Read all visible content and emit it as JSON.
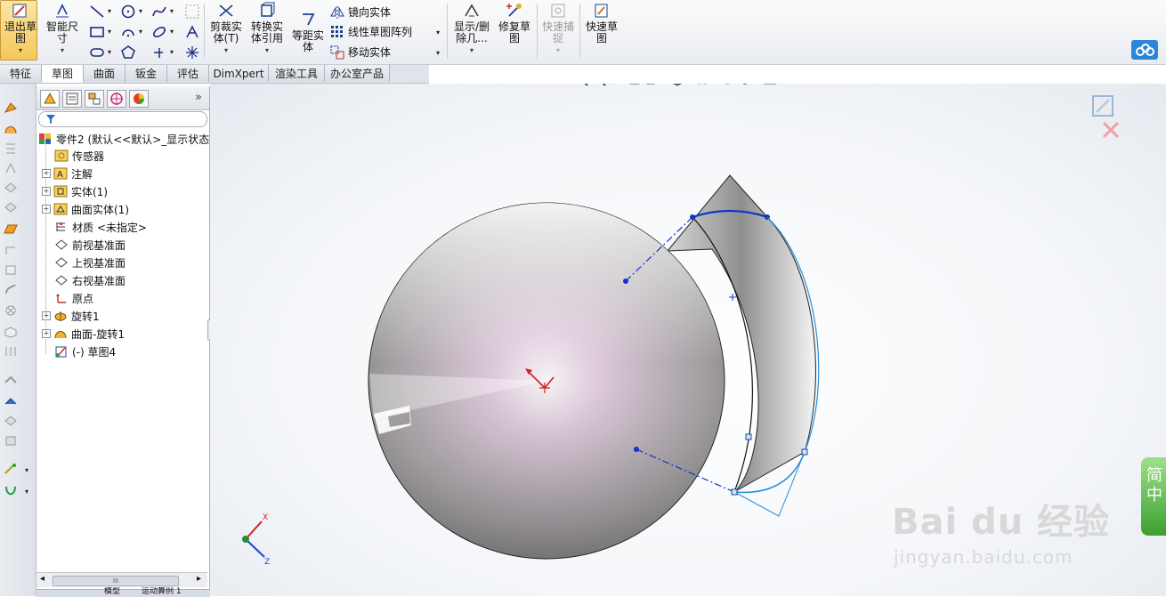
{
  "ribbon": {
    "exit_sketch": "退出草\n图",
    "smart_dim": "智能尺\n寸",
    "trim": "剪裁实\n体(T)",
    "convert": "转换实\n体引用",
    "offset": "等距实\n体",
    "mirror": "镜向实体",
    "linear_pattern": "线性草图阵列",
    "move": "移动实体",
    "show_delete": "显示/删\n除几...",
    "repair": "修复草\n图",
    "quick_snap": "快速捕\n捉",
    "rapid_sketch": "快速草\n图"
  },
  "tabs": [
    "特征",
    "草图",
    "曲面",
    "钣金",
    "评估",
    "DimXpert",
    "渲染工具",
    "办公室产品"
  ],
  "tree": {
    "root": "零件2 (默认<<默认>_显示状态",
    "items": [
      "传感器",
      "注解",
      "实体(1)",
      "曲面实体(1)",
      "材质 <未指定>",
      "前视基准面",
      "上视基准面",
      "右视基准面",
      "原点",
      "旋转1",
      "曲面-旋转1",
      "(-) 草图4"
    ]
  },
  "scroll_label": "III",
  "bottom_tabs": [
    "模型",
    "运动算例 1"
  ],
  "watermark": {
    "brand": "Bai du 经验",
    "url": "jingyan.baidu.com"
  },
  "triad": {
    "x": "X",
    "z": "Z"
  },
  "side_badge": "简\n中",
  "colors": {
    "accent": "#f4c75a",
    "sketch_blue": "#1034c8",
    "sketch_light": "#2b8fd6",
    "ribbon_bg": "#e9ecf1"
  }
}
